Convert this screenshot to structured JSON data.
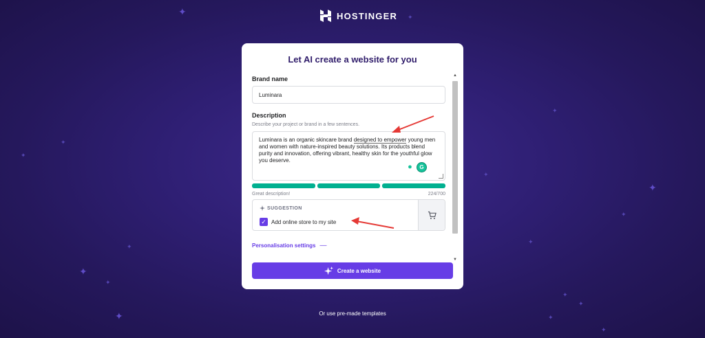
{
  "brand": {
    "logo_text": "HOSTINGER",
    "logo_icon": "hostinger-h-logo"
  },
  "card": {
    "title": "Let AI create a website for you",
    "brand_name": {
      "label": "Brand name",
      "value": "Luminara"
    },
    "description": {
      "label": "Description",
      "hint": "Describe your project or brand in a few sentences.",
      "text_before": "Luminara is an organic skincare brand ",
      "text_underlined": "designed to empower",
      "text_after": " young men and women with nature-inspired beauty solutions. Its products blend purity and innovation, offering vibrant, healthy skin for the youthful glow you deserve.",
      "status": "Great description!",
      "counter": "224/700",
      "progress_segments": 3,
      "progress_fraction": 1.0
    },
    "suggestion": {
      "heading": "SUGGESTION",
      "checkbox_label": "Add online store to my site",
      "checked": true,
      "icon": "cart-icon"
    },
    "personalisation": {
      "label": "Personalisation settings",
      "toggle_symbol": "—"
    },
    "create_button": {
      "label": "Create a website",
      "icon": "sparkle-icon"
    }
  },
  "footer": {
    "templates_link": "Or use pre-made templates"
  },
  "colors": {
    "accent": "#673de6",
    "progress": "#00b090",
    "background": "#2f1f74",
    "annotation_arrow": "#e53935"
  }
}
